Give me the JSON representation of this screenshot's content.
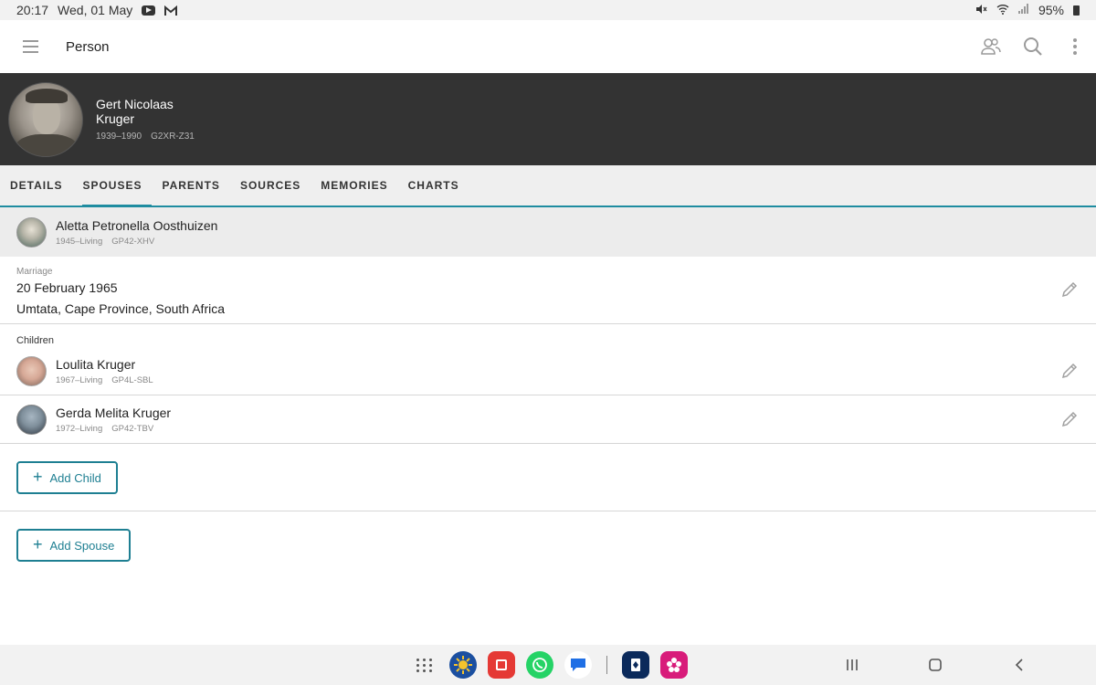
{
  "status_bar": {
    "time": "20:17",
    "date": "Wed, 01 May",
    "battery": "95%"
  },
  "app_bar": {
    "title": "Person",
    "icons": [
      "menu-icon",
      "people-icon",
      "search-icon",
      "more-vert-icon"
    ]
  },
  "person": {
    "given_name": "Gert Nicolaas",
    "surname": "Kruger",
    "lifespan": "1939–1990",
    "pid": "G2XR-Z31"
  },
  "tabs": [
    {
      "label": "DETAILS",
      "active": false
    },
    {
      "label": "SPOUSES",
      "active": true
    },
    {
      "label": "PARENTS",
      "active": false
    },
    {
      "label": "SOURCES",
      "active": false
    },
    {
      "label": "MEMORIES",
      "active": false
    },
    {
      "label": "CHARTS",
      "active": false
    }
  ],
  "spouse": {
    "name": "Aletta Petronella Oosthuizen",
    "lifespan": "1945–Living",
    "pid": "GP42-XHV"
  },
  "marriage": {
    "label": "Marriage",
    "date": "20 February 1965",
    "place": "Umtata, Cape Province, South Africa"
  },
  "children": {
    "label": "Children",
    "items": [
      {
        "name": "Loulita Kruger",
        "lifespan": "1967–Living",
        "pid": "GP4L-SBL"
      },
      {
        "name": "Gerda Melita Kruger",
        "lifespan": "1972–Living",
        "pid": "GP42-TBV"
      }
    ]
  },
  "buttons": {
    "add_child": "Add Child",
    "add_spouse": "Add Spouse"
  },
  "colors": {
    "accent": "#1e8ca0",
    "header_bg": "#333333"
  }
}
